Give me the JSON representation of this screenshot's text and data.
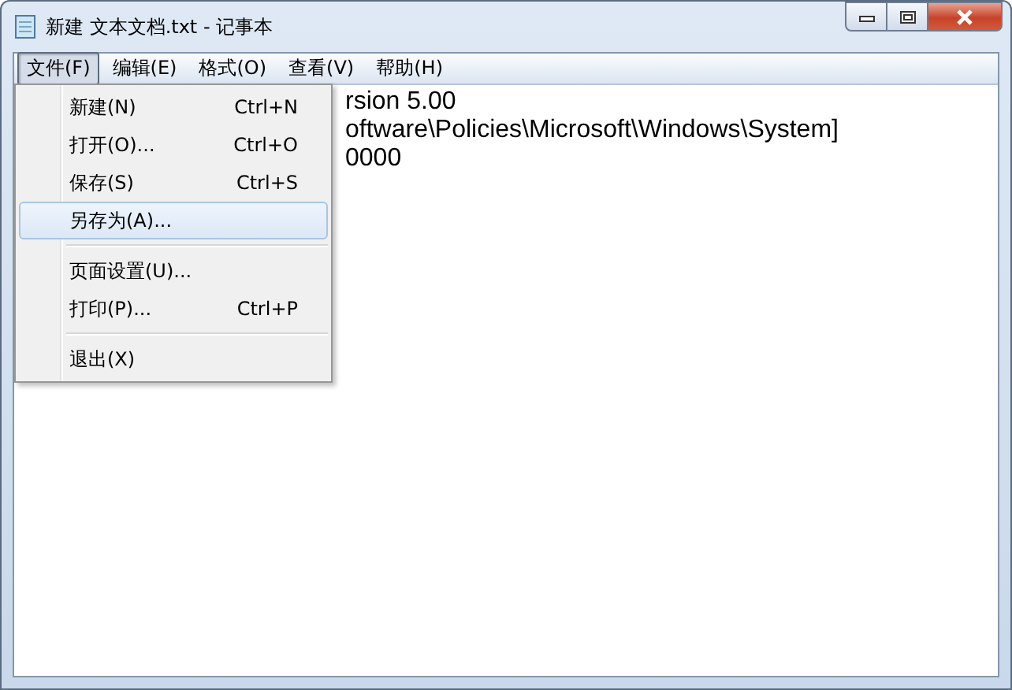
{
  "window": {
    "title": "新建 文本文档.txt - 记事本"
  },
  "menubar": [
    {
      "label": "文件(F)",
      "selected": true
    },
    {
      "label": "编辑(E)",
      "selected": false
    },
    {
      "label": "格式(O)",
      "selected": false
    },
    {
      "label": "查看(V)",
      "selected": false
    },
    {
      "label": "帮助(H)",
      "selected": false
    }
  ],
  "menu": [
    {
      "kind": "item",
      "label": "新建(N)",
      "shortcut": "Ctrl+N",
      "selected": false
    },
    {
      "kind": "item",
      "label": "打开(O)...",
      "shortcut": "Ctrl+O",
      "selected": false
    },
    {
      "kind": "item",
      "label": "保存(S)",
      "shortcut": "Ctrl+S",
      "selected": false
    },
    {
      "kind": "item",
      "label": "另存为(A)...",
      "selected": true
    },
    {
      "kind": "separator"
    },
    {
      "kind": "item",
      "label": "页面设置(U)...",
      "selected": false
    },
    {
      "kind": "item",
      "label": "打印(P)...",
      "shortcut": "Ctrl+P",
      "selected": false
    },
    {
      "kind": "separator"
    },
    {
      "kind": "item",
      "label": "退出(X)",
      "selected": false
    }
  ],
  "editor": {
    "lines": [
      "rsion 5.00",
      "oftware\\Policies\\Microsoft\\Windows\\System]",
      "0000"
    ]
  }
}
